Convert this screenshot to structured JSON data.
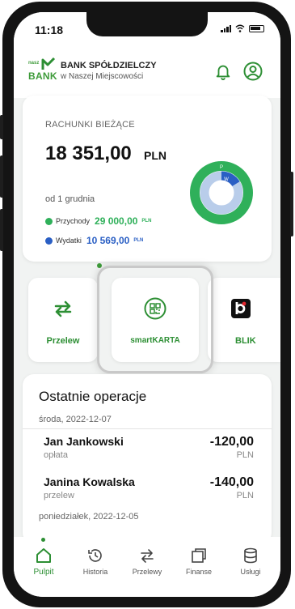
{
  "status": {
    "time": "11:18"
  },
  "header": {
    "logo_small": "nasz",
    "logo_main": "BANK",
    "bank_name": "BANK SPÓŁDZIELCZY",
    "bank_sub": "w Naszej Miejscowości"
  },
  "account": {
    "title": "RACHUNKI BIEŻĄCE",
    "balance": "18 351,00",
    "currency": "PLN",
    "since": "od 1 grudnia",
    "income_label": "Przychody",
    "income_value": "29 000,00",
    "income_currency": "PLN",
    "expense_label": "Wydatki",
    "expense_value": "10 569,00",
    "expense_currency": "PLN",
    "donut_letters": {
      "income": "P",
      "expense": "W"
    },
    "colors": {
      "income": "#2fb05a",
      "expense": "#2a5fc4",
      "accent": "#2d8f34"
    }
  },
  "actions": [
    {
      "label": "Przelew"
    },
    {
      "label": "smartKARTA"
    },
    {
      "label": "BLIK"
    }
  ],
  "operations": {
    "title": "Ostatnie operacje",
    "groups": [
      {
        "date": "środa, 2022-12-07",
        "items": [
          {
            "name": "Jan Jankowski",
            "desc": "opłata",
            "amount": "-120,00",
            "currency": "PLN"
          },
          {
            "name": "Janina Kowalska",
            "desc": "przelew",
            "amount": "-140,00",
            "currency": "PLN"
          }
        ]
      },
      {
        "date": "poniedziałek, 2022-12-05",
        "items": []
      }
    ]
  },
  "nav": {
    "items": [
      {
        "label": "Pulpit",
        "icon": "home-icon",
        "active": true
      },
      {
        "label": "Historia",
        "icon": "history-icon",
        "active": false
      },
      {
        "label": "Przelewy",
        "icon": "transfers-icon",
        "active": false
      },
      {
        "label": "Finanse",
        "icon": "finance-icon",
        "active": false
      },
      {
        "label": "Usługi",
        "icon": "services-icon",
        "active": false
      }
    ]
  }
}
